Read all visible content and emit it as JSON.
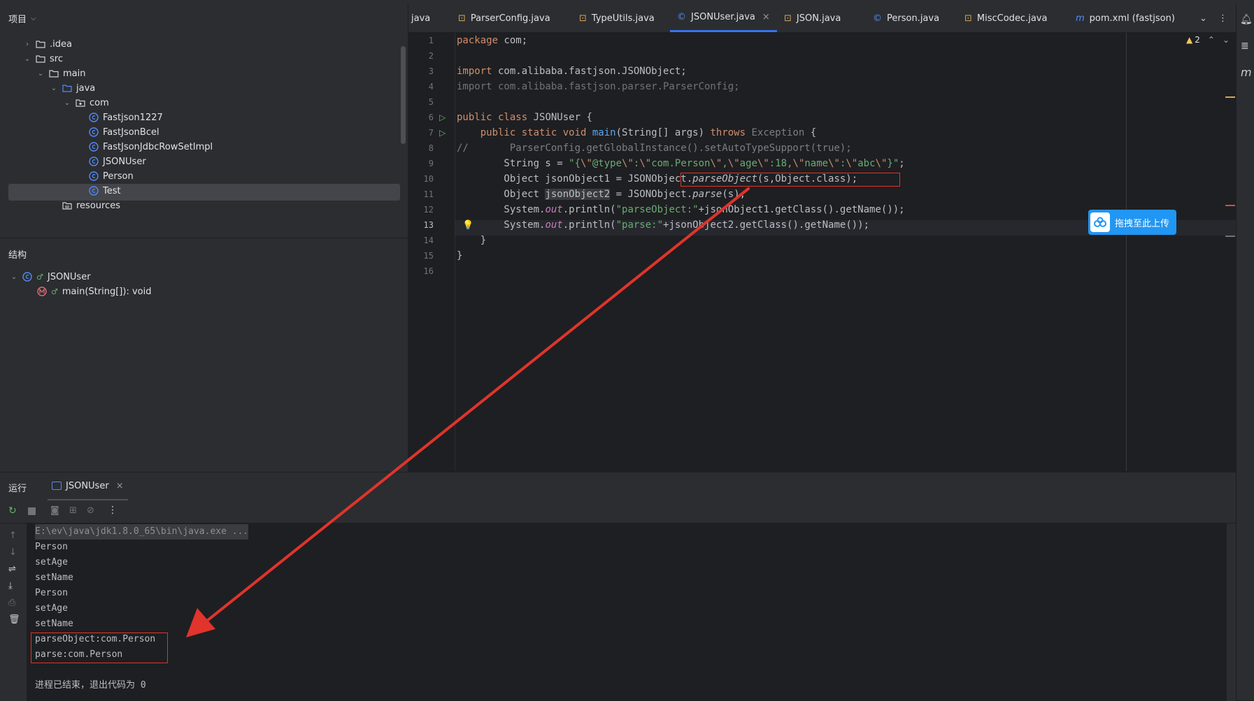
{
  "project_panel": {
    "title": "项目",
    "tree": [
      {
        "label": ".idea",
        "type": "folder"
      },
      {
        "label": "src",
        "type": "folder"
      },
      {
        "label": "main",
        "type": "folder"
      },
      {
        "label": "java",
        "type": "source-folder"
      },
      {
        "label": "com",
        "type": "package"
      },
      {
        "label": "Fastjson1227",
        "type": "class"
      },
      {
        "label": "FastJsonBcel",
        "type": "class"
      },
      {
        "label": "FastJsonJdbcRowSetImpl",
        "type": "class"
      },
      {
        "label": "JSONUser",
        "type": "class"
      },
      {
        "label": "Person",
        "type": "class"
      },
      {
        "label": "Test",
        "type": "class"
      },
      {
        "label": "resources",
        "type": "folder"
      }
    ]
  },
  "structure_panel": {
    "title": "结构",
    "items": [
      {
        "label": "JSONUser"
      },
      {
        "label": "main(String[]): void"
      }
    ]
  },
  "editor": {
    "tabs": [
      {
        "label": "java"
      },
      {
        "label": "ParserConfig.java"
      },
      {
        "label": "TypeUtils.java"
      },
      {
        "label": "JSONUser.java",
        "active": true
      },
      {
        "label": "JSON.java"
      },
      {
        "label": "Person.java"
      },
      {
        "label": "MiscCodec.java"
      },
      {
        "label": "pom.xml (fastjson)"
      }
    ],
    "warning_count": "2",
    "line_numbers": [
      "1",
      "2",
      "3",
      "4",
      "5",
      "6",
      "7",
      "8",
      "9",
      "10",
      "11",
      "12",
      "13",
      "14",
      "15",
      "16"
    ],
    "code": {
      "l1_kw": "package",
      "l1_rest": " com;",
      "l3_kw": "import",
      "l3_rest": " com.alibaba.fastjson.JSONObject;",
      "l4_text": "import com.alibaba.fastjson.parser.ParserConfig;",
      "l6_kw": "public class",
      "l6_rest": " JSONUser {",
      "l7_kw1": "    public static void ",
      "l7_fn": "main",
      "l7_mid": "(String[] args) ",
      "l7_kw2": "throws",
      "l7_exc": " Exception",
      "l7_end": " {",
      "l8_text": "//       ParserConfig.getGlobalInstance().setAutoTypeSupport(true);",
      "l9_a": "        String s = ",
      "l9_str1": "\"{",
      "l9_esc1": "\\\"",
      "l9_str2": "@type",
      "l9_esc2": "\\\"",
      "l9_str3": ":",
      "l9_esc3": "\\\"",
      "l9_str4": "com.Person",
      "l9_esc4": "\\\"",
      "l9_str5": ",",
      "l9_esc5": "\\\"",
      "l9_str6": "age",
      "l9_esc6": "\\\"",
      "l9_str7": ":18,",
      "l9_esc7": "\\\"",
      "l9_str8": "name",
      "l9_esc8": "\\\"",
      "l9_str9": ":",
      "l9_esc9": "\\\"",
      "l9_str10": "abc",
      "l9_esc10": "\\\"",
      "l9_str11": "}\"",
      "l9_end": ";",
      "l10_a": "        Object jsonObject1 = JSONObject.",
      "l10_method": "parseObject",
      "l10_args": "(s,Object.class);",
      "l11_a": "        Object ",
      "l11_var": "jsonObject2",
      "l11_b": " = JSONObject.",
      "l11_method": "parse",
      "l11_end": "(s);",
      "l12_a": "        System.",
      "l12_out": "out",
      "l12_b": ".println(",
      "l12_str": "\"parseObject:\"",
      "l12_end": "+jsonObject1.getClass().getName());",
      "l13_a": "        System.",
      "l13_out": "out",
      "l13_b": ".println(",
      "l13_str": "\"parse:\"",
      "l13_end": "+jsonObject2.getClass().getName());",
      "l14_text": "    }",
      "l15_text": "}"
    }
  },
  "upload_button": {
    "label": "拖拽至此上传"
  },
  "run_panel": {
    "title": "运行",
    "tab_label": "JSONUser",
    "console_lines": [
      "E:\\ev\\java\\jdk1.8.0_65\\bin\\java.exe ...",
      "Person",
      "setAge",
      "setName",
      "Person",
      "setAge",
      "setName",
      "parseObject:com.Person",
      "parse:com.Person",
      "",
      "进程已结束，退出代码为 0"
    ]
  },
  "colors": {
    "accent": "#3574f0",
    "annotation_red": "#e0342c",
    "upload_blue": "#2196f3"
  }
}
